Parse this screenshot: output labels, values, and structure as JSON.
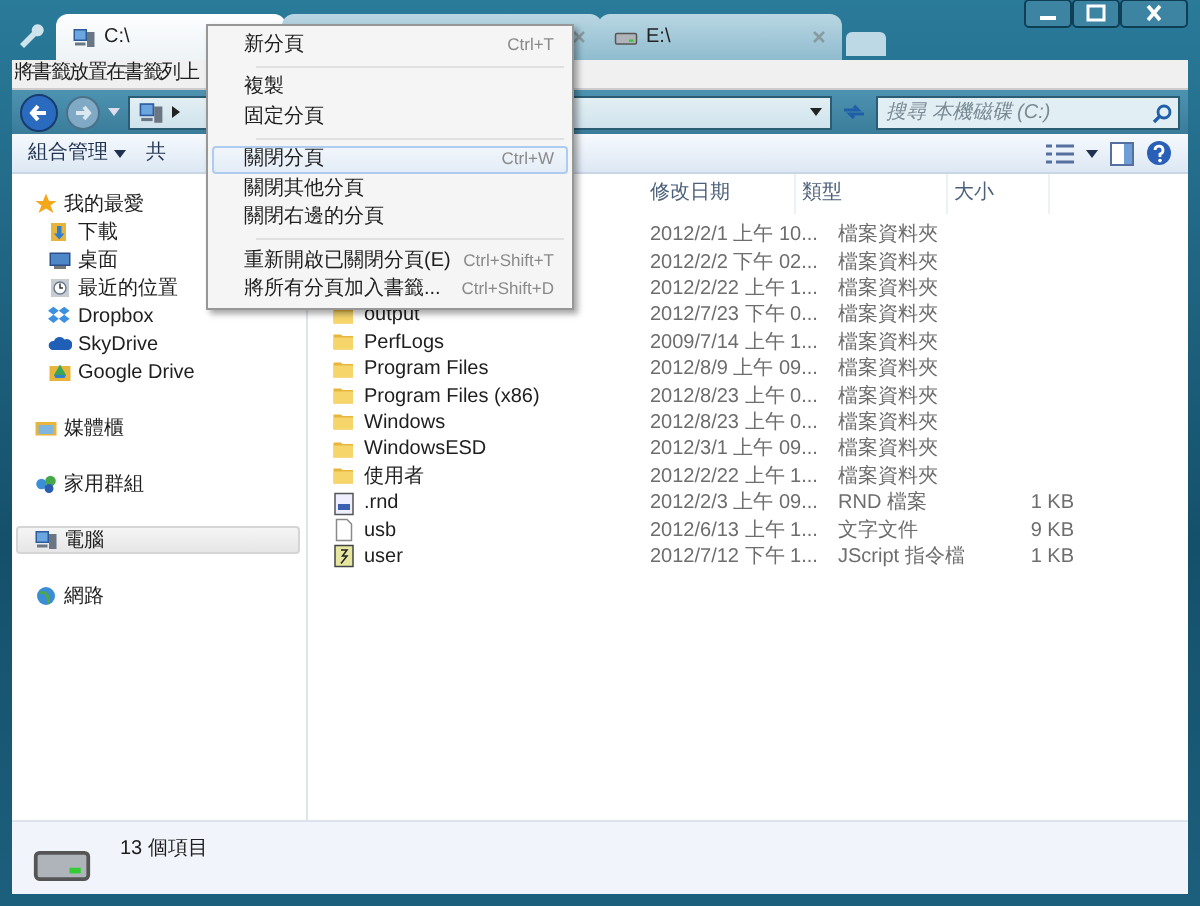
{
  "tabs": [
    {
      "label": "C:\\",
      "kind": "computer",
      "selected": true
    },
    {
      "selected": false
    },
    {
      "label": "E:\\",
      "kind": "drive",
      "selected": false
    }
  ],
  "bookmark_bar": {
    "hint": "將書籤放置在書籤列上"
  },
  "search": {
    "placeholder": "搜尋 本機磁碟 (C:)"
  },
  "toolbar": {
    "buttons": [
      {
        "label": "組合管理",
        "dropdown": true
      },
      {
        "label": "共",
        "dropdown": false
      }
    ]
  },
  "sidebar": {
    "groups": [
      {
        "label": "我的最愛",
        "kind": "star",
        "selected": false,
        "children": [
          {
            "label": "下載",
            "kind": "download",
            "selected": false
          },
          {
            "label": "桌面",
            "kind": "desktop",
            "selected": false
          },
          {
            "label": "最近的位置",
            "kind": "recent",
            "selected": false
          },
          {
            "label": "Dropbox",
            "kind": "dropbox",
            "selected": false
          },
          {
            "label": "SkyDrive",
            "kind": "cloud",
            "selected": false
          },
          {
            "label": "Google Drive",
            "kind": "gdrive",
            "selected": false
          }
        ]
      },
      {
        "label": "媒體櫃",
        "kind": "library",
        "selected": false
      },
      {
        "label": "家用群組",
        "kind": "homegroup",
        "selected": false
      },
      {
        "label": "電腦",
        "kind": "computer",
        "selected": true
      },
      {
        "label": "網路",
        "kind": "network",
        "selected": false
      }
    ]
  },
  "file_list": {
    "columns": [
      "修改日期",
      "類型",
      "大小"
    ],
    "rows": [
      {
        "date": "2012/2/1 上午 10...",
        "type": "檔案資料夾"
      },
      {
        "date": "2012/2/2 下午 02...",
        "type": "檔案資料夾"
      },
      {
        "date": "2012/2/22 上午 1...",
        "type": "檔案資料夾"
      },
      {
        "name": "output",
        "date": "2012/7/23 下午 0...",
        "type": "檔案資料夾",
        "kind": "folder"
      },
      {
        "name": "PerfLogs",
        "date": "2009/7/14 上午 1...",
        "type": "檔案資料夾",
        "kind": "folder"
      },
      {
        "name": "Program Files",
        "date": "2012/8/9 上午 09...",
        "type": "檔案資料夾",
        "kind": "folder"
      },
      {
        "name": "Program Files (x86)",
        "date": "2012/8/23 上午 0...",
        "type": "檔案資料夾",
        "kind": "folder"
      },
      {
        "name": "Windows",
        "date": "2012/8/23 上午 0...",
        "type": "檔案資料夾",
        "kind": "folder"
      },
      {
        "name": "WindowsESD",
        "date": "2012/3/1 上午 09...",
        "type": "檔案資料夾",
        "kind": "folder"
      },
      {
        "name": "使用者",
        "date": "2012/2/22 上午 1...",
        "type": "檔案資料夾",
        "kind": "folder"
      },
      {
        "name": ".rnd",
        "date": "2012/2/3 上午 09...",
        "type": "RND 檔案",
        "size": "1 KB",
        "kind": "binary"
      },
      {
        "name": "usb",
        "date": "2012/6/13 上午 1...",
        "type": "文字文件",
        "size": "9 KB",
        "kind": "text"
      },
      {
        "name": "user",
        "date": "2012/7/12 下午 1...",
        "type": "JScript 指令檔",
        "size": "1 KB",
        "kind": "script"
      }
    ]
  },
  "context_menu": {
    "sections": [
      [
        {
          "label": "新分頁",
          "shortcut": "Ctrl+T",
          "selected": false
        }
      ],
      [
        {
          "label": "複製",
          "selected": false
        },
        {
          "label": "固定分頁",
          "selected": false
        }
      ],
      [
        {
          "label": "關閉分頁",
          "shortcut": "Ctrl+W",
          "selected": true
        },
        {
          "label": "關閉其他分頁",
          "selected": false
        },
        {
          "label": "關閉右邊的分頁",
          "selected": false
        }
      ],
      [
        {
          "label": "重新開啟已關閉分頁(E)",
          "shortcut": "Ctrl+Shift+T",
          "selected": false
        },
        {
          "label": "將所有分頁加入書籤...",
          "shortcut": "Ctrl+Shift+D",
          "selected": false
        }
      ]
    ]
  },
  "status_bar": {
    "count": "13 個項目"
  }
}
